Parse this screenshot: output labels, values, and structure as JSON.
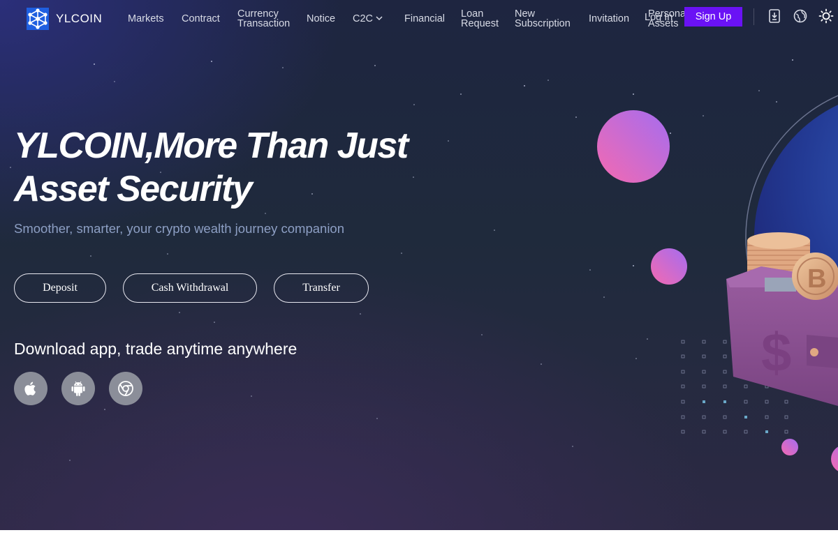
{
  "brand": {
    "name": "YLCOIN"
  },
  "nav": {
    "markets": "Markets",
    "contract": "Contract",
    "currency_line1": "Currency",
    "currency_line2": "Transaction",
    "notice": "Notice",
    "c2c": "C2C",
    "financial": "Financial",
    "loan_line1": "Loan",
    "loan_line2": "Request",
    "subscription_line1": "New",
    "subscription_line2": "Subscription",
    "invitation": "Invitation",
    "personal_line1": "Personal",
    "personal_line2": "Assets",
    "login": "Log In",
    "signup": "Sign Up"
  },
  "icons": {
    "download": "download-icon",
    "language": "globe-icon",
    "theme": "sun-icon"
  },
  "hero": {
    "headline_line1": "YLCOIN,More Than Just",
    "headline_line2": "Asset Security",
    "subline": "Smoother, smarter, your crypto wealth journey companion",
    "buttons": {
      "deposit": "Deposit",
      "withdraw": "Cash Withdrawal",
      "transfer": "Transfer"
    },
    "download_title": "Download app, trade anytime anywhere",
    "apps": [
      "apple-icon",
      "android-icon",
      "chrome-icon"
    ]
  },
  "colors": {
    "accent": "#6a12f5",
    "nav_text": "#d8dbe6",
    "subline": "#8d9fc4",
    "sphere_pink": "#f06ab0",
    "sphere_purple": "#a86af0",
    "wallet": "#8a4f8c"
  }
}
